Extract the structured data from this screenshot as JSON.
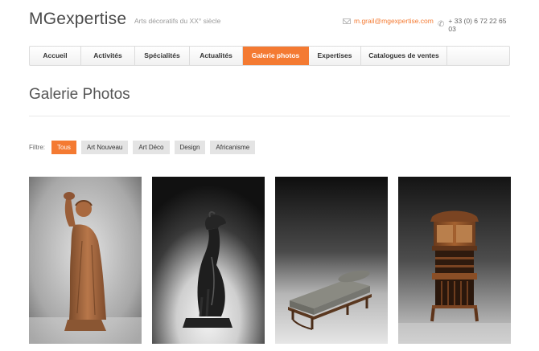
{
  "header": {
    "logo": "MGexpertise",
    "tagline": "Arts décoratifs du XX° siècle",
    "email": "m.grail@mgexpertise.com",
    "phone": "+ 33 (0) 6 72 22 65 03"
  },
  "nav": {
    "items": [
      {
        "label": "Accueil"
      },
      {
        "label": "Activités"
      },
      {
        "label": "Spécialités"
      },
      {
        "label": "Actualités"
      },
      {
        "label": "Galerie photos",
        "active": true
      },
      {
        "label": "Expertises"
      },
      {
        "label": "Catalogues de ventes"
      }
    ]
  },
  "page": {
    "title": "Galerie Photos"
  },
  "filter": {
    "label": "Filtre:",
    "options": [
      {
        "label": "Tous",
        "active": true
      },
      {
        "label": "Art Nouveau"
      },
      {
        "label": "Art Déco"
      },
      {
        "label": "Design"
      },
      {
        "label": "Africanisme"
      }
    ]
  },
  "gallery": {
    "items": [
      {
        "subject": "terracotta-figure-sculpture"
      },
      {
        "subject": "bronze-dog-sculpture"
      },
      {
        "subject": "daybed-chaise"
      },
      {
        "subject": "art-nouveau-cabinet"
      }
    ]
  },
  "colors": {
    "accent": "#f47a32",
    "nav_border": "#dcdcdc",
    "chip_bg": "#e4e4e4",
    "text": "#444444"
  }
}
